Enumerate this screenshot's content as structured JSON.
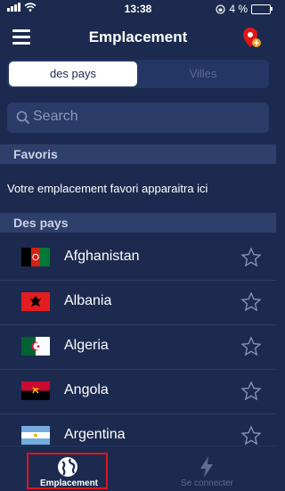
{
  "status_bar": {
    "time": "13:38",
    "battery": "4 %"
  },
  "header": {
    "title": "Emplacement"
  },
  "segments": {
    "countries_label": "des pays",
    "cities_label": "Villes"
  },
  "search": {
    "placeholder": "Search"
  },
  "favorites": {
    "header": "Favoris",
    "empty_message": "Votre emplacement favori apparaitra ici"
  },
  "countries": {
    "header": "Des pays",
    "items": [
      {
        "name": "Afghanistan",
        "flag": "flag-afghanistan-icon"
      },
      {
        "name": "Albania",
        "flag": "flag-albania-icon"
      },
      {
        "name": "Algeria",
        "flag": "flag-algeria-icon"
      },
      {
        "name": "Angola",
        "flag": "flag-angola-icon"
      },
      {
        "name": "Argentina",
        "flag": "flag-argentina-icon"
      }
    ]
  },
  "tabbar": {
    "location_label": "Emplacement",
    "connect_label": "Se connecter"
  },
  "colors": {
    "background": "#1b2a4e",
    "section": "#2e3f6b",
    "highlight": "#e0141b"
  }
}
